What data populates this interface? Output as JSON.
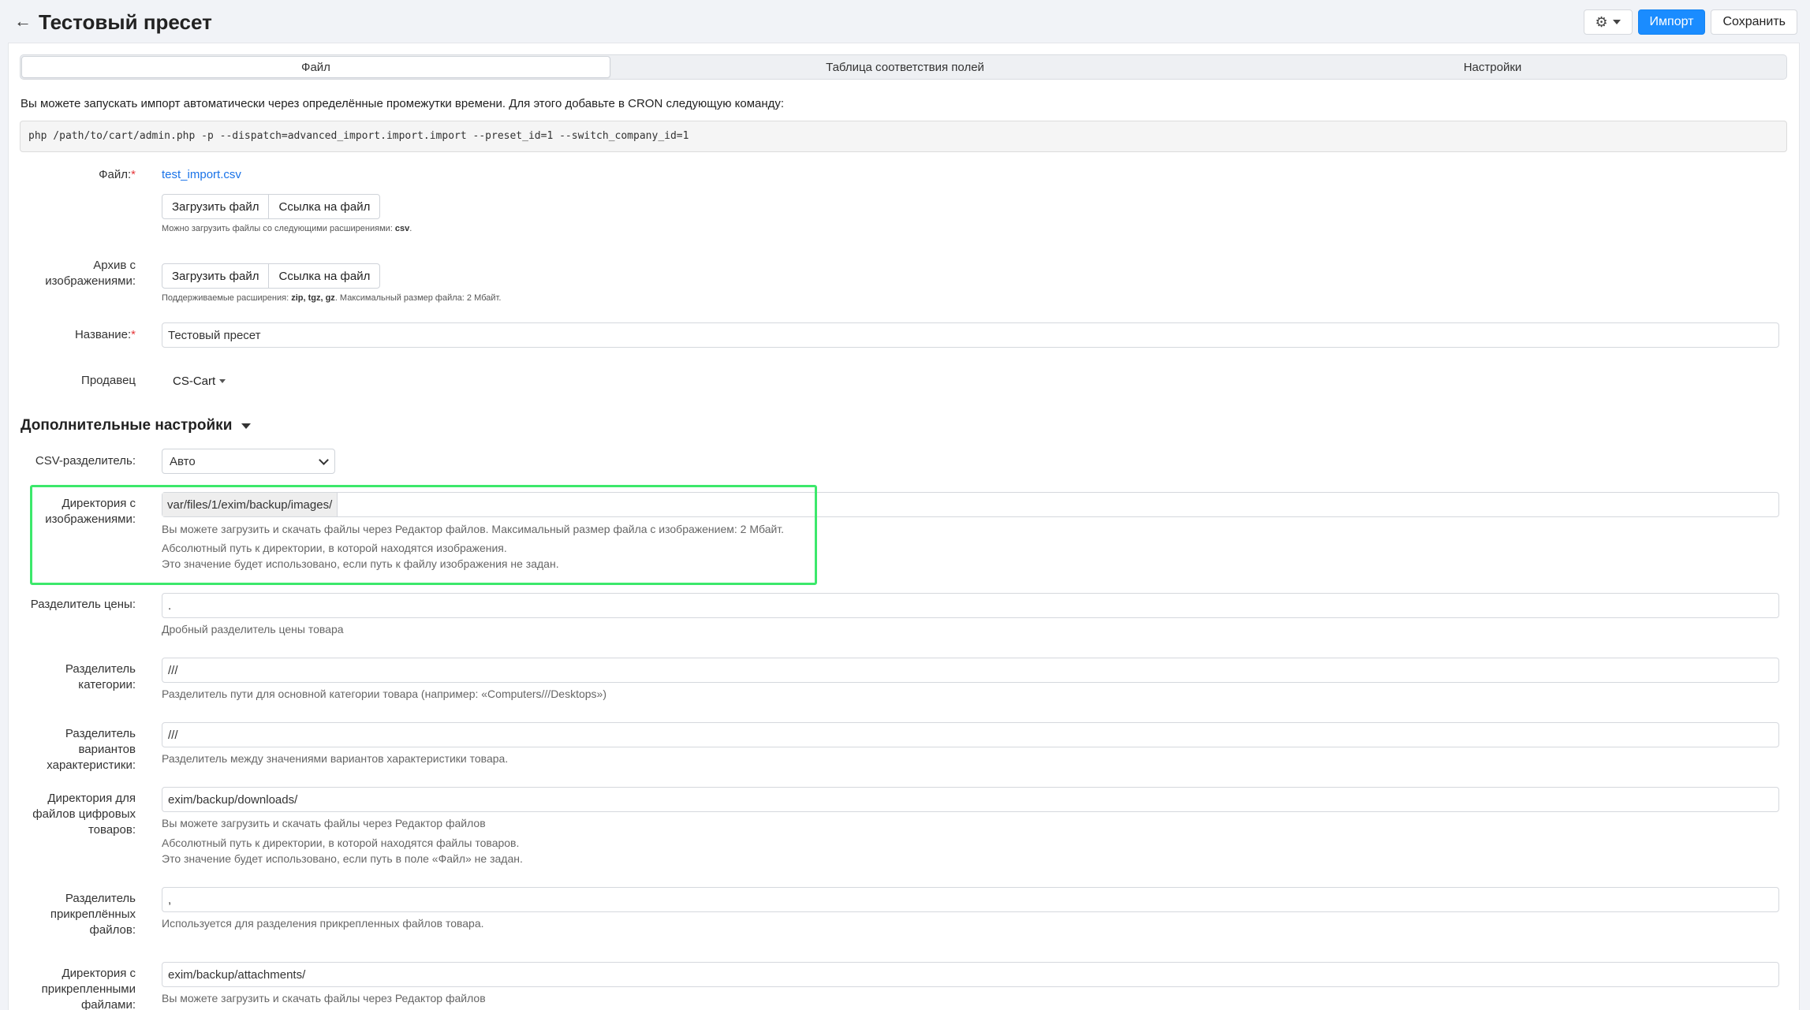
{
  "header": {
    "back_icon": "arrow-left-icon",
    "title": "Тестовый пресет",
    "settings_icon": "gear-icon",
    "import_label": "Импорт",
    "save_label": "Сохранить"
  },
  "tabs": [
    {
      "label": "Файл",
      "active": true
    },
    {
      "label": "Таблица соответствия полей",
      "active": false
    },
    {
      "label": "Настройки",
      "active": false
    }
  ],
  "cron": {
    "note": "Вы можете запускать импорт автоматически через определённые промежутки времени. Для этого добавьте в CRON следующую команду:",
    "command": "php /path/to/cart/admin.php -p --dispatch=advanced_import.import.import --preset_id=1 --switch_company_id=1"
  },
  "file": {
    "label": "Файл:",
    "filename": "test_import.csv",
    "upload_label": "Загрузить файл",
    "url_label": "Ссылка на файл",
    "hint_prefix": "Можно загрузить файлы со следующими расширениями:",
    "hint_ext": "csv",
    "hint_suffix": "."
  },
  "archive": {
    "label_line1": "Архив с",
    "label_line2": "изображениями:",
    "upload_label": "Загрузить файл",
    "url_label": "Ссылка на файл",
    "hint_prefix": "Поддерживаемые расширения:",
    "hint_ext": "zip, tgz, gz",
    "hint_suffix": ". Максимальный размер файла: 2 Мбайт."
  },
  "name": {
    "label": "Название:",
    "value": "Тестовый пресет"
  },
  "vendor": {
    "label": "Продавец",
    "value": "CS-Cart"
  },
  "advanced": {
    "title": "Дополнительные настройки"
  },
  "csv_delimiter": {
    "label": "CSV-разделитель:",
    "value": "Авто"
  },
  "images_dir": {
    "label_line1": "Директория с",
    "label_line2": "изображениями:",
    "prefix": "var/files/1/exim/backup/images/",
    "value": "",
    "hint1": "Вы можете загрузить и скачать файлы через Редактор файлов. Максимальный размер файла с изображением: 2 Мбайт.",
    "hint2": "Абсолютный путь к директории, в которой находятся изображения.",
    "hint3": "Это значение будет использовано, если путь к файлу изображения не задан."
  },
  "price_delimiter": {
    "label": "Разделитель цены:",
    "value": ".",
    "hint": "Дробный разделитель цены товара"
  },
  "category_delimiter": {
    "label_line1": "Разделитель",
    "label_line2": "категории:",
    "value": "///",
    "hint": "Разделитель пути для основной категории товара (например: «Computers///Desktops»)"
  },
  "feature_delimiter": {
    "label_line1": "Разделитель вариантов",
    "label_line2": "характеристики:",
    "value": "///",
    "hint": "Разделитель между значениями вариантов характеристики товара."
  },
  "downloads_dir": {
    "label_line1": "Директория для",
    "label_line2": "файлов цифровых",
    "label_line3": "товаров:",
    "value": "exim/backup/downloads/",
    "hint1": "Вы можете загрузить и скачать файлы через Редактор файлов",
    "hint2": "Абсолютный путь к директории, в которой находятся файлы товаров.",
    "hint3": "Это значение будет использовано, если путь в поле «Файл» не задан."
  },
  "attachments_delimiter": {
    "label_line1": "Разделитель",
    "label_line2": "прикреплённых",
    "label_line3": "файлов:",
    "value": ",",
    "hint": "Используется для разделения прикрепленных файлов товара."
  },
  "attachments_dir": {
    "label_line1": "Директория с",
    "label_line2": "прикрепленными",
    "label_line3": "файлами:",
    "value": "exim/backup/attachments/",
    "hint1": "Вы можете загрузить и скачать файлы через Редактор файлов"
  },
  "colors": {
    "primary": "#1a8cff",
    "highlight": "#3ce86b",
    "link": "#1a73e8",
    "required": "#e5383b"
  }
}
